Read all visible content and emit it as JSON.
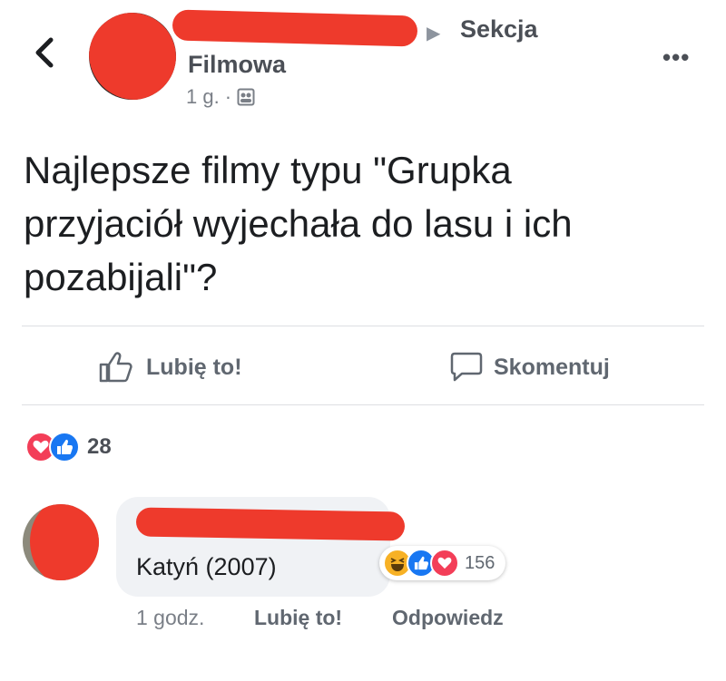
{
  "post": {
    "group_name_line1": "Sekcja",
    "group_name_line2": "Filmowa",
    "time": "1 g.",
    "separator": "·",
    "text": "Najlepsze filmy typu \"Grupka\nprzyjaciół wyjechała do lasu i ich\npozabijali\"?",
    "icons": {
      "back": "back-chevron-icon",
      "arrow": "arrow-right-icon",
      "audience": "audience-icon",
      "more": "more-dots-icon"
    }
  },
  "actions": {
    "like_label": "Lubię to!",
    "comment_label": "Skomentuj"
  },
  "reactions": {
    "types": [
      "love",
      "like"
    ],
    "count": "28"
  },
  "comment": {
    "text": "Katyń (2007)",
    "reaction_types": [
      "haha",
      "like",
      "love"
    ],
    "reaction_count": "156",
    "time": "1 godz.",
    "like_label": "Lubię to!",
    "reply_label": "Odpowiedz"
  },
  "colors": {
    "like_blue": "#1877f2",
    "love_red": "#f33e58",
    "haha_yellow": "#f7b125",
    "redaction_red": "#ee3a2c"
  }
}
